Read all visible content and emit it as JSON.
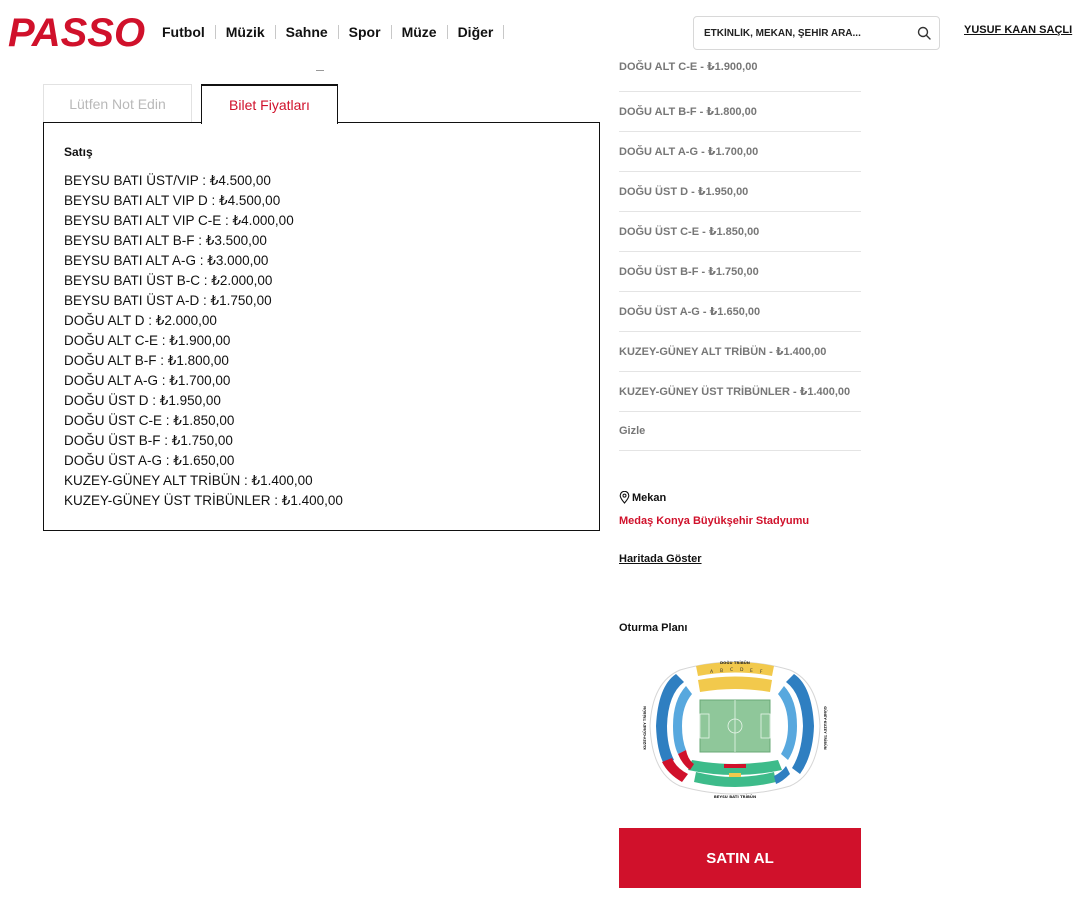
{
  "header": {
    "logo": "PASSO",
    "nav": [
      "Futbol",
      "Müzik",
      "Sahne",
      "Spor",
      "Müze",
      "Diğer"
    ],
    "search_placeholder": "ETKİNLİK, MEKAN, ŞEHİR ARA...",
    "user": "YUSUF KAAN SAÇLI"
  },
  "tabs": {
    "notes": "Lütfen Not Edin",
    "prices": "Bilet Fiyatları"
  },
  "prices": {
    "heading": "Satış",
    "items": [
      "BEYSU BATI ÜST/VIP : ₺4.500,00",
      "BEYSU BATI ALT VIP D : ₺4.500,00",
      "BEYSU BATI ALT VIP C-E : ₺4.000,00",
      "BEYSU BATI ALT B-F : ₺3.500,00",
      "BEYSU BATI ALT A-G : ₺3.000,00",
      "BEYSU BATI ÜST B-C : ₺2.000,00",
      "BEYSU BATI ÜST A-D : ₺1.750,00",
      "DOĞU ALT D : ₺2.000,00",
      "DOĞU ALT C-E : ₺1.900,00",
      "DOĞU ALT B-F : ₺1.800,00",
      "DOĞU ALT A-G : ₺1.700,00",
      "DOĞU ÜST D : ₺1.950,00",
      "DOĞU ÜST C-E : ₺1.850,00",
      "DOĞU ÜST B-F : ₺1.750,00",
      "DOĞU ÜST A-G : ₺1.650,00",
      "KUZEY-GÜNEY ALT TRİBÜN : ₺1.400,00",
      "KUZEY-GÜNEY ÜST TRİBÜNLER : ₺1.400,00"
    ]
  },
  "categories": {
    "clipped": "DOĞU ALT C-E - ₺1.900,00",
    "items": [
      "DOĞU ALT B-F - ₺1.800,00",
      "DOĞU ALT A-G - ₺1.700,00",
      "DOĞU ÜST D - ₺1.950,00",
      "DOĞU ÜST C-E - ₺1.850,00",
      "DOĞU ÜST B-F - ₺1.750,00",
      "DOĞU ÜST A-G - ₺1.650,00",
      "KUZEY-GÜNEY ALT TRİBÜN - ₺1.400,00",
      "KUZEY-GÜNEY ÜST TRİBÜNLER - ₺1.400,00",
      "Gizle"
    ]
  },
  "venue": {
    "label": "Mekan",
    "name": "Medaş Konya Büyükşehir Stadyumu",
    "map_link": "Haritada Göster"
  },
  "seating": {
    "label": "Oturma Planı",
    "top_label": "DOĞU TRİBÜN",
    "bottom_label": "BEYSU BATI TRİBÜN",
    "left_label": "KUZEY-GÜNEY TRİBÜN",
    "right_label": "GÜNEY-KUZEY TRİBÜN",
    "sectors": [
      "A",
      "B",
      "C",
      "D",
      "E",
      "F",
      "G"
    ]
  },
  "buy_button": "SATIN AL",
  "colors": {
    "brand": "#d0112b",
    "stand_yellow": "#f2c94c",
    "stand_blue": "#2f7fc1",
    "stand_light_blue": "#58a8de",
    "stand_green": "#3dbb8a",
    "stand_red": "#d0112b",
    "pitch": "#8fc79a"
  }
}
